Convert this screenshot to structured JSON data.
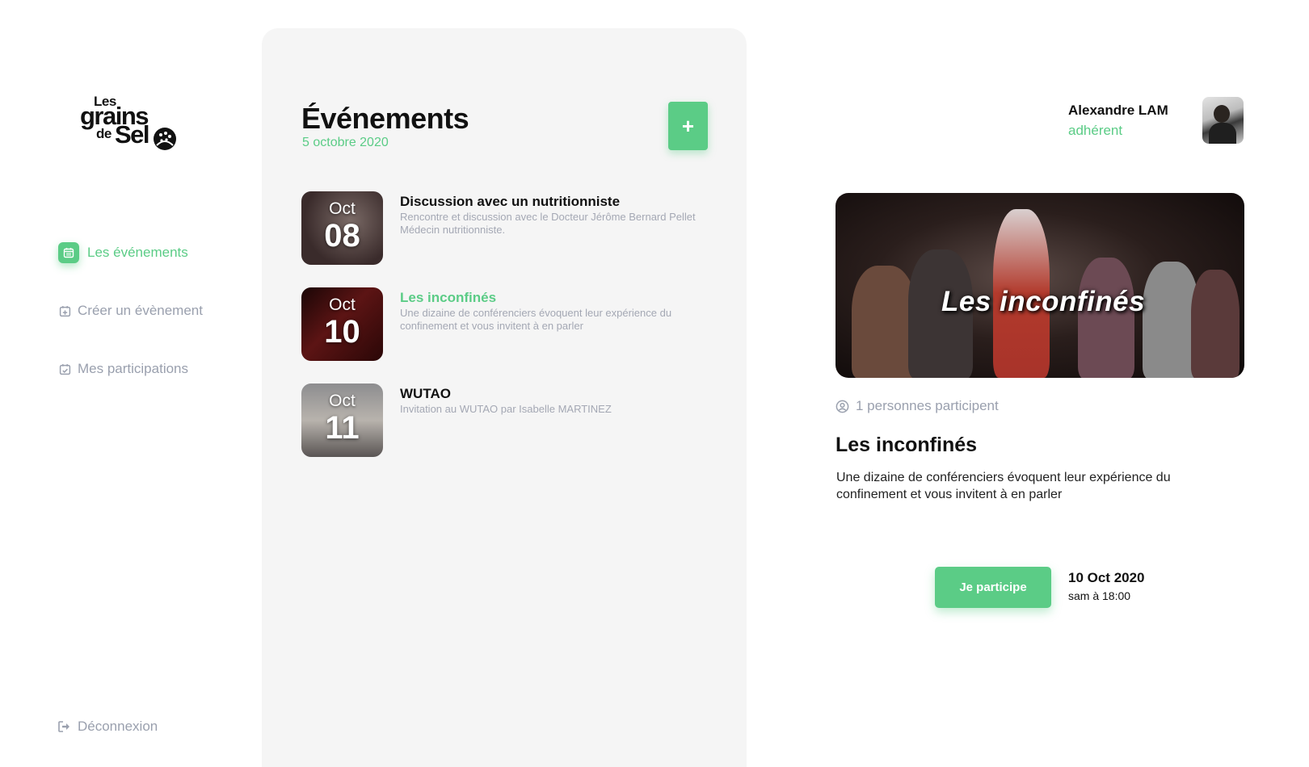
{
  "sidebar": {
    "logo": {
      "line1": "Les",
      "line2": "grains",
      "line3": "de",
      "line4": "Sel"
    },
    "items": [
      {
        "label": "Les événements",
        "icon": "calendar-icon",
        "active": true
      },
      {
        "label": "Créer un évènement",
        "icon": "calendar-plus-icon",
        "active": false
      },
      {
        "label": "Mes participations",
        "icon": "calendar-check-icon",
        "active": false
      }
    ],
    "logout": {
      "label": "Déconnexion",
      "icon": "logout-icon"
    }
  },
  "events_panel": {
    "title": "Événements",
    "date": "5 octobre 2020",
    "add_label": "+",
    "events": [
      {
        "month": "Oct",
        "day": "08",
        "title": "Discussion avec un nutritionniste",
        "description": "Rencontre et discussion avec le Docteur Jérôme Bernard Pellet Médecin nutritionniste.",
        "selected": false
      },
      {
        "month": "Oct",
        "day": "10",
        "title": "Les inconfinés",
        "description": "Une dizaine de conférenciers évoquent leur expérience du confinement et vous invitent à en parler",
        "selected": true
      },
      {
        "month": "Oct",
        "day": "11",
        "title": "WUTAO",
        "description": "Invitation au WUTAO par Isabelle MARTINEZ",
        "selected": false
      }
    ]
  },
  "user": {
    "name": "Alexandre LAM",
    "role": "adhérent"
  },
  "detail": {
    "image_caption": "Les inconfinés",
    "participants": "1 personnes participent",
    "title": "Les inconfinés",
    "description": "Une dizaine de conférenciers évoquent leur expérience du confinement et vous invitent à en parler",
    "join_label": "Je participe",
    "date": "10 Oct 2020",
    "time": "sam à 18:00"
  },
  "colors": {
    "accent": "#5bcc86",
    "muted": "#9aa0ae",
    "panel": "#f5f5f5"
  }
}
